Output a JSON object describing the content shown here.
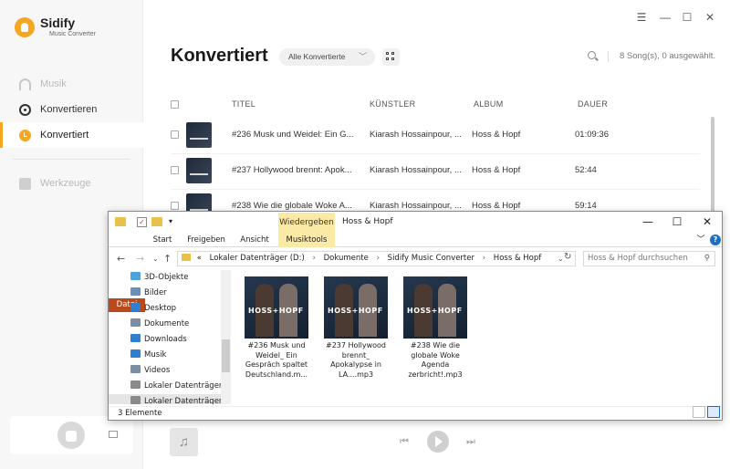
{
  "app": {
    "name": "Sidify",
    "subtitle": "Music Converter",
    "accent": "#f5a623"
  },
  "sidebar": {
    "items": [
      {
        "label": "Musik",
        "icon": "headphones-icon",
        "state": "disabled"
      },
      {
        "label": "Konvertieren",
        "icon": "convert-icon",
        "state": "normal"
      },
      {
        "label": "Konvertiert",
        "icon": "clock-icon",
        "state": "active"
      },
      {
        "label": "Werkzeuge",
        "icon": "toolbox-icon",
        "state": "disabled"
      }
    ]
  },
  "window_controls": [
    "☰",
    "—",
    "☐",
    "✕"
  ],
  "main": {
    "title": "Konvertiert",
    "filter": "Alle Konvertierte",
    "count": "8 Song(s), 0 ausgewählt.",
    "columns": [
      "TITEL",
      "KÜNSTLER",
      "ALBUM",
      "DAUER"
    ],
    "rows": [
      {
        "title": "#236 Musk und Weidel: Ein G...",
        "artist": "Kiarash Hossainpour, ...",
        "album": "Hoss & Hopf",
        "duration": "01:09:36"
      },
      {
        "title": "#237 Hollywood brennt: Apok...",
        "artist": "Kiarash Hossainpour, ...",
        "album": "Hoss & Hopf",
        "duration": "52:44"
      },
      {
        "title": "#238 Wie die globale Woke A...",
        "artist": "Kiarash Hossainpour, ...",
        "album": "Hoss & Hopf",
        "duration": "59:14"
      }
    ]
  },
  "explorer": {
    "window_title": "Hoss & Hopf",
    "context_tab": "Wiedergeben",
    "ribbon_tabs": [
      "Datei",
      "Start",
      "Freigeben",
      "Ansicht",
      "Musiktools"
    ],
    "address_prefix": "«",
    "breadcrumb": [
      "Lokaler Datenträger (D:)",
      "Dokumente",
      "Sidify Music Converter",
      "Hoss & Hopf"
    ],
    "search_placeholder": "Hoss & Hopf durchsuchen",
    "tree": [
      {
        "label": "3D-Objekte",
        "color": "#4aa3df"
      },
      {
        "label": "Bilder",
        "color": "#6a8fb8"
      },
      {
        "label": "Desktop",
        "color": "#2f7fd1"
      },
      {
        "label": "Dokumente",
        "color": "#7b8ea6"
      },
      {
        "label": "Downloads",
        "color": "#2f7fd1"
      },
      {
        "label": "Musik",
        "color": "#2f7fd1"
      },
      {
        "label": "Videos",
        "color": "#7b8ea6"
      },
      {
        "label": "Lokaler Datenträger (C",
        "color": "#8a8a8a"
      },
      {
        "label": "Lokaler Datenträger (D",
        "color": "#8a8a8a"
      }
    ],
    "files": [
      {
        "name": "#236 Musk und Weidel_ Ein Gespräch spaltet Deutschland.m...",
        "cover_text": "HOSS+HOPF"
      },
      {
        "name": "#237 Hollywood brennt_ Apokalypse in LA....mp3",
        "cover_text": "HOSS+HOPF"
      },
      {
        "name": "#238 Wie die globale Woke Agenda zerbricht!.mp3",
        "cover_text": "HOSS+HOPF"
      }
    ],
    "status": "3 Elemente"
  }
}
